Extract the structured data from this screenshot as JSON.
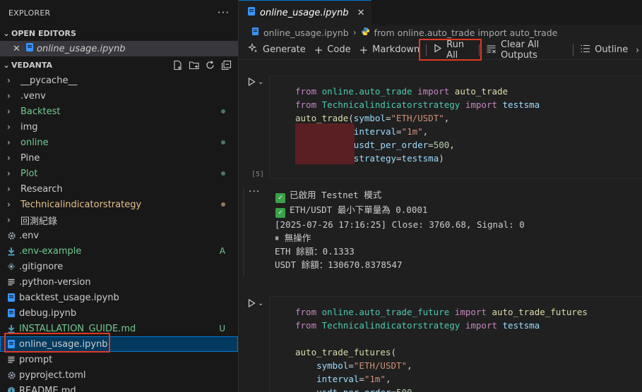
{
  "explorer": {
    "title": "EXPLORER",
    "more": "···",
    "open_editors_title": "OPEN EDITORS",
    "open_editor_file": "online_usage.ipynb",
    "workspace_title": "VEDANTA"
  },
  "tree": [
    {
      "name": "__pycache__",
      "kind": "folder",
      "color": "#cccccc"
    },
    {
      "name": ".venv",
      "kind": "folder",
      "color": "#cccccc"
    },
    {
      "name": "Backtest",
      "kind": "folder",
      "color": "#73c991",
      "deco": "dot-green"
    },
    {
      "name": "img",
      "kind": "folder",
      "color": "#cccccc"
    },
    {
      "name": "online",
      "kind": "folder",
      "color": "#73c991",
      "deco": "dot-green"
    },
    {
      "name": "Pine",
      "kind": "folder",
      "color": "#cccccc"
    },
    {
      "name": "Plot",
      "kind": "folder",
      "color": "#73c991",
      "deco": "dot-green"
    },
    {
      "name": "Research",
      "kind": "folder",
      "color": "#cccccc"
    },
    {
      "name": "Technicalindicatorstrategy",
      "kind": "folder",
      "color": "#e2c08d",
      "deco": "dot-yellow"
    },
    {
      "name": "回測紀錄",
      "kind": "folder",
      "color": "#cccccc"
    },
    {
      "name": ".env",
      "kind": "gear",
      "color": "#cccccc"
    },
    {
      "name": ".env-example",
      "kind": "download",
      "color": "#73c991",
      "badge": "A"
    },
    {
      "name": ".gitignore",
      "kind": "git",
      "color": "#cccccc"
    },
    {
      "name": ".python-version",
      "kind": "lines",
      "color": "#cccccc"
    },
    {
      "name": "backtest_usage.ipynb",
      "kind": "notebook",
      "color": "#cccccc"
    },
    {
      "name": "debug.ipynb",
      "kind": "notebook",
      "color": "#cccccc"
    },
    {
      "name": "INSTALLATION_GUIDE.md",
      "kind": "download",
      "color": "#73c991",
      "badge": "U"
    },
    {
      "name": "online_usage.ipynb",
      "kind": "notebook",
      "color": "#cccccc",
      "selected": true
    },
    {
      "name": "prompt",
      "kind": "lines",
      "color": "#cccccc"
    },
    {
      "name": "pyproject.toml",
      "kind": "gear",
      "color": "#cccccc"
    },
    {
      "name": "README.md",
      "kind": "info",
      "color": "#cccccc"
    }
  ],
  "editor": {
    "tab_label": "online_usage.ipynb",
    "breadcrumb_file": "online_usage.ipynb",
    "breadcrumb_symbol": "from online.auto_trade import auto_trade"
  },
  "toolbar": {
    "generate": "Generate",
    "code": "Code",
    "markdown": "Markdown",
    "run_all": "Run All",
    "clear_outputs": "Clear All Outputs",
    "outline": "Outline"
  },
  "cell1": {
    "exec_count": "[5]",
    "lines": [
      [
        [
          "kw",
          "from "
        ],
        [
          "mod2",
          "online.auto_trade "
        ],
        [
          "kw",
          "import "
        ],
        [
          "fn",
          "auto_trade"
        ]
      ],
      [
        [
          "kw",
          "from "
        ],
        [
          "mod2",
          "Technicalindicatorstrategy "
        ],
        [
          "kw",
          "import "
        ],
        [
          "param",
          "testsma"
        ]
      ],
      [
        [
          "fn",
          "auto_trade"
        ],
        [
          "plain",
          "("
        ],
        [
          "param",
          "symbol"
        ],
        [
          "plain",
          "="
        ],
        [
          "str",
          "\"ETH/USDT\""
        ],
        [
          "plain",
          ","
        ]
      ],
      [
        [
          "plain",
          "           "
        ],
        [
          "param",
          "interval"
        ],
        [
          "plain",
          "="
        ],
        [
          "str",
          "\"1m\""
        ],
        [
          "plain",
          ","
        ]
      ],
      [
        [
          "plain",
          "           "
        ],
        [
          "param",
          "usdt_per_order"
        ],
        [
          "plain",
          "="
        ],
        [
          "num",
          "500"
        ],
        [
          "plain",
          ","
        ]
      ],
      [
        [
          "plain",
          "           "
        ],
        [
          "param",
          "strategy"
        ],
        [
          "plain",
          "="
        ],
        [
          "param",
          "testsma"
        ],
        [
          "plain",
          ")"
        ]
      ]
    ]
  },
  "output1": {
    "lines": [
      {
        "check": true,
        "text": "已啟用 Testnet 模式"
      },
      {
        "check": true,
        "text": "ETH/USDT 最小下單量為 0.0001"
      },
      {
        "check": false,
        "text": "[2025-07-26 17:16:25] Close: 3760.68, Signal: 0"
      },
      {
        "check": false,
        "text": "⏸ 無操作"
      },
      {
        "check": false,
        "text": "ETH 餘額：0.1333"
      },
      {
        "check": false,
        "text": "USDT 餘額：130670.8378547"
      }
    ]
  },
  "cell2": {
    "lines": [
      [
        [
          "kw",
          "from "
        ],
        [
          "mod2",
          "online.auto_trade_future "
        ],
        [
          "kw",
          "import "
        ],
        [
          "fn",
          "auto_trade_futures"
        ]
      ],
      [
        [
          "kw",
          "from "
        ],
        [
          "mod2",
          "Technicalindicatorstrategy "
        ],
        [
          "kw",
          "import "
        ],
        [
          "param",
          "testsma"
        ]
      ],
      [
        [
          "plain",
          " "
        ]
      ],
      [
        [
          "fn",
          "auto_trade_futures"
        ],
        [
          "plain",
          "("
        ]
      ],
      [
        [
          "plain",
          "    "
        ],
        [
          "param",
          "symbol"
        ],
        [
          "plain",
          "="
        ],
        [
          "str",
          "\"ETH/USDT\""
        ],
        [
          "plain",
          ","
        ]
      ],
      [
        [
          "plain",
          "    "
        ],
        [
          "param",
          "interval"
        ],
        [
          "plain",
          "="
        ],
        [
          "str",
          "\"1m\""
        ],
        [
          "plain",
          ","
        ]
      ],
      [
        [
          "plain",
          "    "
        ],
        [
          "param",
          "usdt_per_order"
        ],
        [
          "plain",
          "="
        ],
        [
          "num",
          "500"
        ],
        [
          "plain",
          ","
        ]
      ]
    ]
  },
  "colors": {
    "highlight": "#e03a25",
    "accent": "#0078d4",
    "git_added": "#73c991",
    "git_modified": "#e2c08d",
    "redaction": "#5a1f22"
  }
}
